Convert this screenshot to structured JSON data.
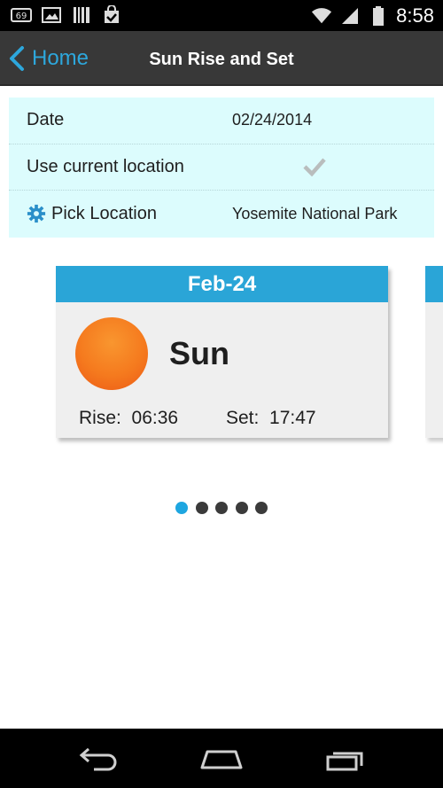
{
  "status_bar": {
    "notification_badge": "69",
    "time": "8:58"
  },
  "action_bar": {
    "back_label": "Home",
    "title": "Sun Rise and Set"
  },
  "form": {
    "date_label": "Date",
    "date_value": "02/24/2014",
    "use_location_label": "Use current location",
    "use_location_checked": true,
    "pick_location_label": "Pick Location",
    "pick_location_value": "Yosemite National Park"
  },
  "card": {
    "date": "Feb-24",
    "name": "Sun",
    "rise_label": "Rise:",
    "rise_time": "06:36",
    "set_label": "Set:",
    "set_time": "17:47"
  },
  "pager": {
    "pages": 5,
    "active_index": 0
  },
  "colors": {
    "accent": "#2aa5d7",
    "action_bar": "#383838",
    "form_bg": "#dcfcfd",
    "sun": "#f57a1e",
    "pager_active": "#1ea6e0",
    "pager_inactive": "#3b3b3b"
  },
  "icons": {
    "back": "chevron-left-icon",
    "check": "checkmark-icon",
    "pick_location": "gear-icon",
    "nav_back": "back-arrow-icon",
    "nav_home": "home-icon",
    "nav_recents": "recent-apps-icon"
  }
}
